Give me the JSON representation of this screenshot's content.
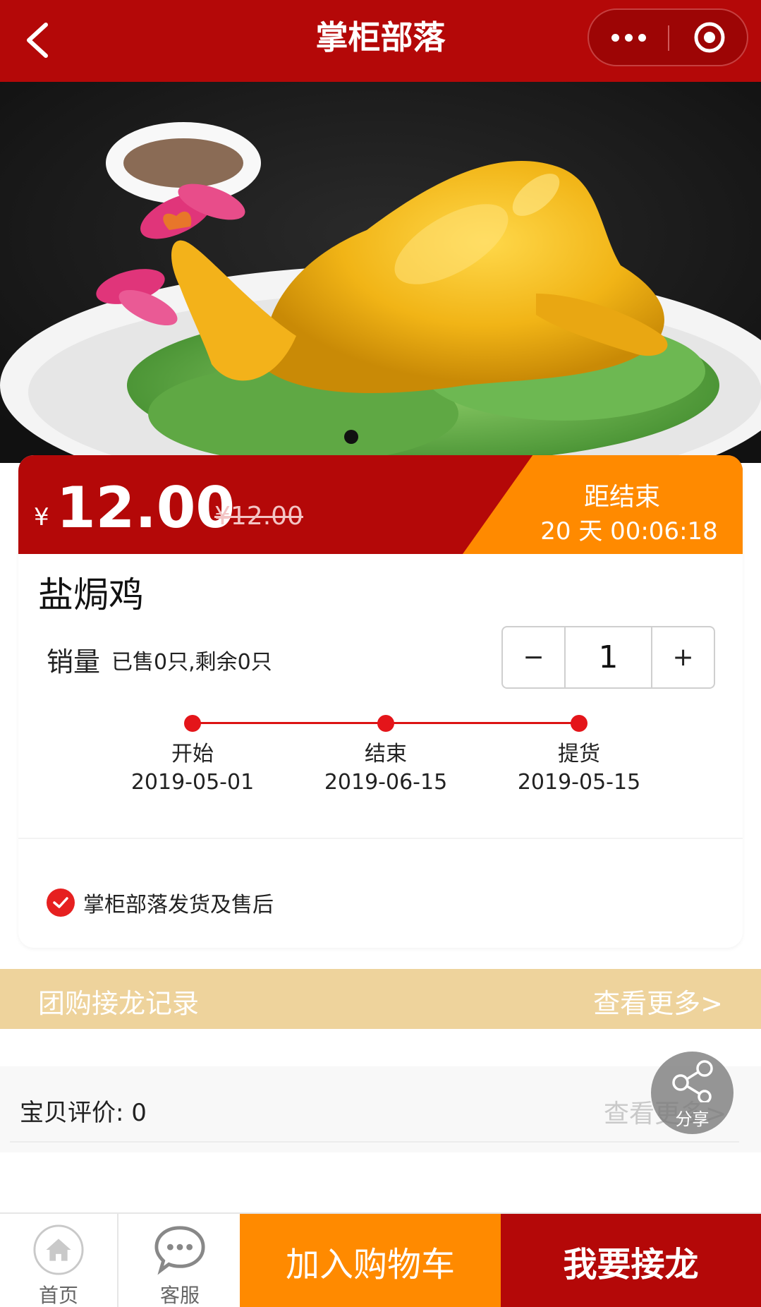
{
  "nav": {
    "title": "掌柜部落",
    "back_icon": "back-arrow-icon",
    "more_icon": "more-dots-icon",
    "close_icon": "target-circle-icon"
  },
  "hero": {
    "image": "salted-baked-chicken-photo",
    "slide_count": 1,
    "active_slide": 1
  },
  "price": {
    "currency": "¥",
    "current": "12.00",
    "original": "¥12.00",
    "countdown_label": "距结束",
    "countdown_value": "20 天 00:06:18"
  },
  "product": {
    "name": "盐焗鸡",
    "sales_label": "销量",
    "sales_text": "已售0只,剩余0只",
    "quantity": "1",
    "minus": "−",
    "plus": "+"
  },
  "timeline": [
    {
      "label": "开始",
      "date": "2019-05-01"
    },
    {
      "label": "结束",
      "date": "2019-06-15"
    },
    {
      "label": "提货",
      "date": "2019-05-15"
    }
  ],
  "guarantee": {
    "text": "掌柜部落发货及售后",
    "icon": "check-circle-icon"
  },
  "group_buy": {
    "title": "团购接龙记录",
    "more": "查看更多>"
  },
  "review": {
    "label": "宝贝评价: 0",
    "more": "查看更多>"
  },
  "share": {
    "label": "分享",
    "icon": "share-icon"
  },
  "bottom_bar": {
    "home_label": "首页",
    "service_label": "客服",
    "cart_button": "加入购物车",
    "join_button": "我要接龙"
  },
  "colors": {
    "brand_red": "#b40808",
    "accent_orange": "#ff8a00",
    "banner_beige": "#eed39c",
    "timeline_red": "#e4151a"
  }
}
